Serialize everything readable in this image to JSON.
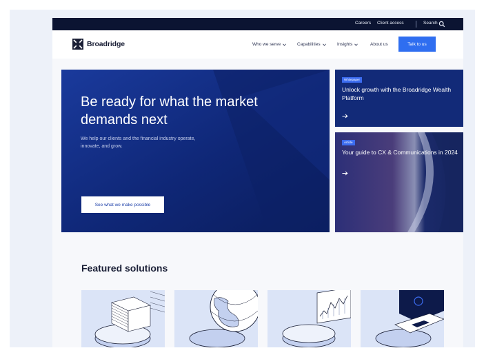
{
  "utility_nav": {
    "careers": "Careers",
    "client_access": "Client access",
    "search": "Search"
  },
  "brand": {
    "name": "Broadridge"
  },
  "main_nav": {
    "items": [
      {
        "label": "Who we serve",
        "has_dropdown": true
      },
      {
        "label": "Capabilities",
        "has_dropdown": true
      },
      {
        "label": "Insights",
        "has_dropdown": true
      },
      {
        "label": "About us",
        "has_dropdown": false
      }
    ],
    "cta": "Talk to us"
  },
  "hero": {
    "title": "Be ready for what the market demands next",
    "subtitle": "We help our clients and the financial industry operate, innovate, and grow.",
    "cta": "See what we make possible"
  },
  "cards": [
    {
      "badge": "Whitepaper",
      "title": "Unlock growth with the Broadridge Wealth Platform",
      "icon": "arrow-right-icon"
    },
    {
      "badge": "Article",
      "title": "Your guide to CX & Communications in 2024",
      "icon": "arrow-right-icon"
    }
  ],
  "featured": {
    "title": "Featured solutions",
    "tiles": [
      {
        "illustration": "document-stack-icon"
      },
      {
        "illustration": "globe-icon"
      },
      {
        "illustration": "chart-panel-icon"
      },
      {
        "illustration": "laptop-icon"
      }
    ]
  },
  "colors": {
    "utility_bar": "#0b1432",
    "brand_blue": "#2f6ef0",
    "hero_navy": "#0f2777",
    "page_bg": "#f7f8fb",
    "tile_bg": "#dbe4f7"
  }
}
